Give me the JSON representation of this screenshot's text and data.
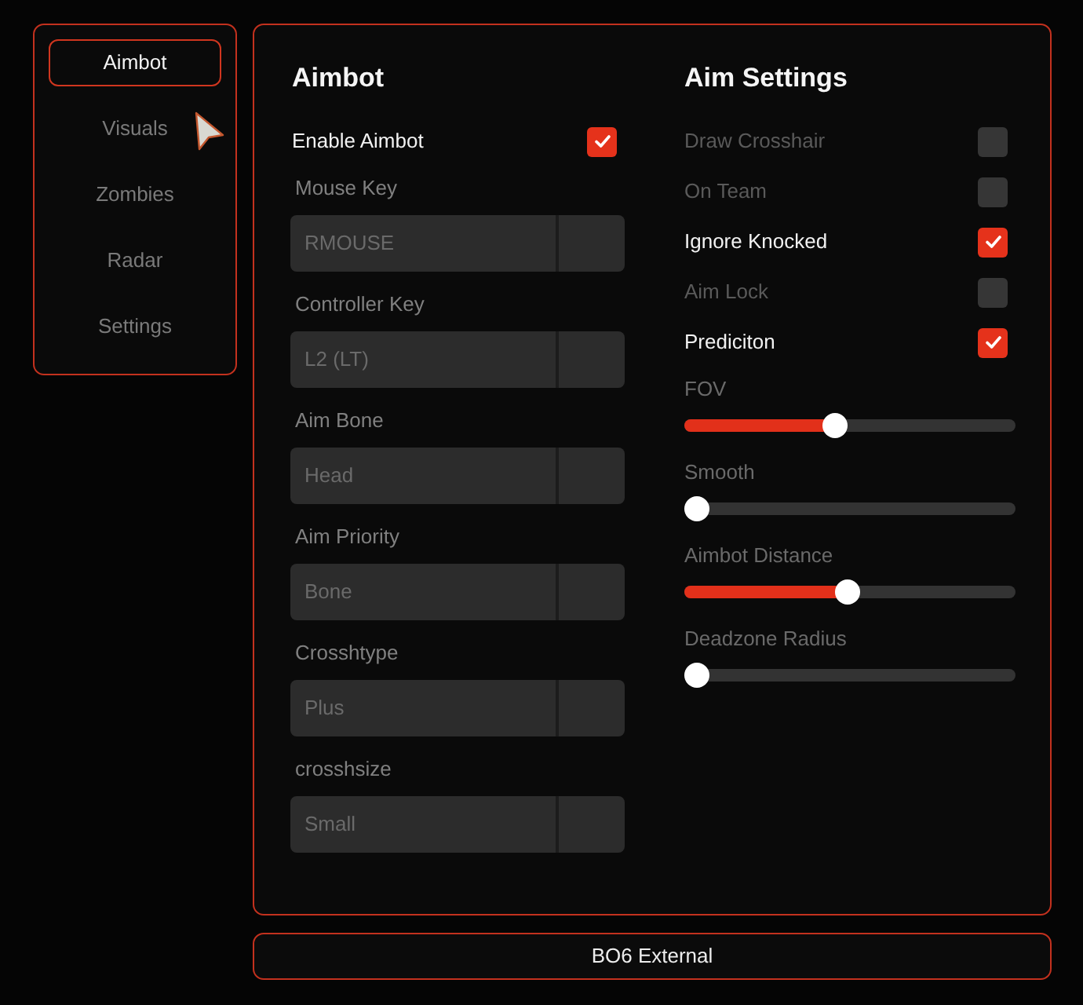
{
  "sidebar": {
    "items": [
      {
        "label": "Aimbot",
        "selected": true
      },
      {
        "label": "Visuals",
        "selected": false
      },
      {
        "label": "Zombies",
        "selected": false
      },
      {
        "label": "Radar",
        "selected": false
      },
      {
        "label": "Settings",
        "selected": false
      }
    ]
  },
  "main": {
    "left": {
      "title": "Aimbot",
      "toggle": {
        "label": "Enable Aimbot",
        "checked": true
      },
      "dropdowns": [
        {
          "label": "Mouse Key",
          "value": "RMOUSE"
        },
        {
          "label": "Controller Key",
          "value": "L2 (LT)"
        },
        {
          "label": "Aim Bone",
          "value": "Head"
        },
        {
          "label": "Aim Priority",
          "value": "Bone"
        },
        {
          "label": "Crosshtype",
          "value": "Plus"
        },
        {
          "label": "crosshsize",
          "value": "Small"
        }
      ]
    },
    "right": {
      "title": "Aim Settings",
      "checkboxes": [
        {
          "label": "Draw Crosshair",
          "checked": false
        },
        {
          "label": "On Team",
          "checked": false
        },
        {
          "label": "Ignore Knocked",
          "checked": true
        },
        {
          "label": "Aim Lock",
          "checked": false
        },
        {
          "label": "Prediciton",
          "checked": true
        }
      ],
      "sliders": [
        {
          "label": "FOV",
          "level": 0.45
        },
        {
          "label": "Smooth",
          "level": 0
        },
        {
          "label": "Aimbot Distance",
          "level": 0.49
        },
        {
          "label": "Deadzone Radius",
          "level": 0
        }
      ]
    }
  },
  "footer": {
    "title": "BO6 External"
  }
}
